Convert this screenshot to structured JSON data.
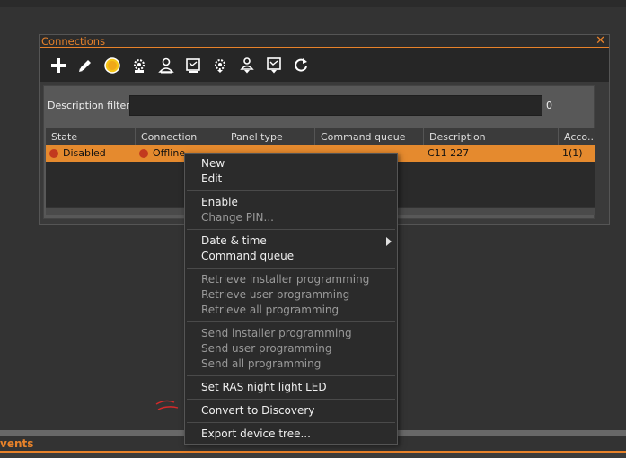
{
  "window": {
    "title": "Connections",
    "close_glyph": "✕"
  },
  "toolbar": {
    "buttons": [
      {
        "name": "add",
        "icon": "plus-icon"
      },
      {
        "name": "edit",
        "icon": "pencil-icon"
      },
      {
        "name": "status",
        "icon": "circle-indicator-icon"
      },
      {
        "name": "settings-a",
        "icon": "gear-person-icon"
      },
      {
        "name": "user-a",
        "icon": "user-icon"
      },
      {
        "name": "panel-a",
        "icon": "panel-config-icon"
      },
      {
        "name": "settings-b",
        "icon": "gear-down-icon"
      },
      {
        "name": "user-b",
        "icon": "user-down-icon"
      },
      {
        "name": "panel-b",
        "icon": "panel-down-icon"
      },
      {
        "name": "refresh",
        "icon": "refresh-icon"
      }
    ]
  },
  "filter": {
    "label": "Description filter:",
    "value": "",
    "count": "0"
  },
  "table": {
    "columns": [
      "State",
      "Connection",
      "Panel type",
      "Command queue",
      "Description",
      "Acco..."
    ],
    "rows": [
      {
        "state": "Disabled",
        "connection": "Offline",
        "panel_type": "",
        "command_queue": "",
        "description": "C11 227",
        "account": "1(1)"
      }
    ]
  },
  "events": {
    "title": "vents"
  },
  "context_menu": {
    "groups": [
      [
        {
          "label": "New",
          "enabled": true
        },
        {
          "label": "Edit",
          "enabled": true
        }
      ],
      [
        {
          "label": "Enable",
          "enabled": true
        },
        {
          "label": "Change PIN...",
          "enabled": false
        }
      ],
      [
        {
          "label": "Date & time",
          "enabled": true,
          "submenu": true
        },
        {
          "label": "Command queue",
          "enabled": true
        }
      ],
      [
        {
          "label": "Retrieve installer programming",
          "enabled": false
        },
        {
          "label": "Retrieve user programming",
          "enabled": false
        },
        {
          "label": "Retrieve all programming",
          "enabled": false
        }
      ],
      [
        {
          "label": "Send installer programming",
          "enabled": false
        },
        {
          "label": "Send user programming",
          "enabled": false
        },
        {
          "label": "Send all programming",
          "enabled": false
        }
      ],
      [
        {
          "label": "Set RAS night light LED",
          "enabled": true
        }
      ],
      [
        {
          "label": "Convert to Discovery",
          "enabled": true
        }
      ],
      [
        {
          "label": "Export device tree...",
          "enabled": true
        }
      ]
    ]
  },
  "colors": {
    "accent": "#e8822a",
    "selected_row": "#e58a2e",
    "status_dot": "#c23a1e",
    "annotation": "#d42a2a"
  }
}
